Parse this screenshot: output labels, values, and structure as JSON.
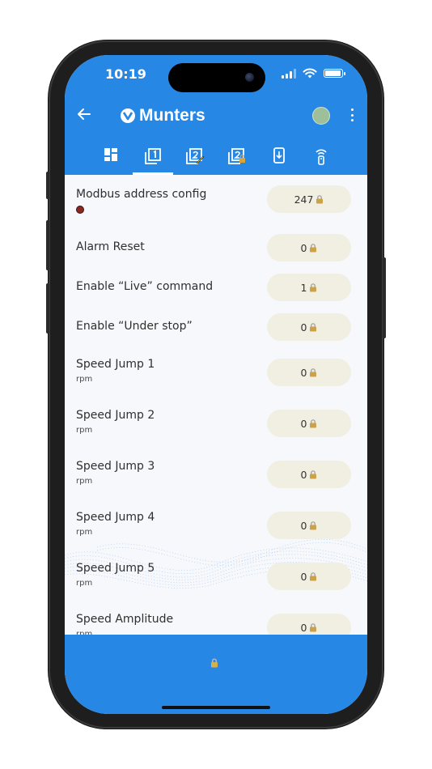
{
  "status_bar": {
    "time": "10:19"
  },
  "header": {
    "brand": "Munters",
    "status_color": "#9dc09b",
    "accent": "#2787e4"
  },
  "tabs": [
    {
      "name": "dashboard-icon",
      "active": false
    },
    {
      "name": "page-1-icon",
      "active": true,
      "number": "1"
    },
    {
      "name": "page-2-edit-icon",
      "active": false,
      "number": "2"
    },
    {
      "name": "page-2-lock-icon",
      "active": false,
      "number": "2"
    },
    {
      "name": "device-download-icon",
      "active": false
    },
    {
      "name": "remote-icon",
      "active": false
    }
  ],
  "rows": [
    {
      "label": "Modbus address config",
      "unit": "",
      "value": "247",
      "badge": true
    },
    {
      "label": "Alarm Reset",
      "unit": "",
      "value": "0"
    },
    {
      "label": "Enable “Live” command",
      "unit": "",
      "value": "1"
    },
    {
      "label": "Enable “Under stop”",
      "unit": "",
      "value": "0"
    },
    {
      "label": "Speed Jump 1",
      "unit": "rpm",
      "value": "0"
    },
    {
      "label": "Speed Jump 2",
      "unit": "rpm",
      "value": "0"
    },
    {
      "label": "Speed Jump 3",
      "unit": "rpm",
      "value": "0"
    },
    {
      "label": "Speed Jump 4",
      "unit": "rpm",
      "value": "0"
    },
    {
      "label": "Speed Jump 5",
      "unit": "rpm",
      "value": "0"
    },
    {
      "label": "Speed Amplitude",
      "unit": "rpm",
      "value": "0"
    }
  ]
}
